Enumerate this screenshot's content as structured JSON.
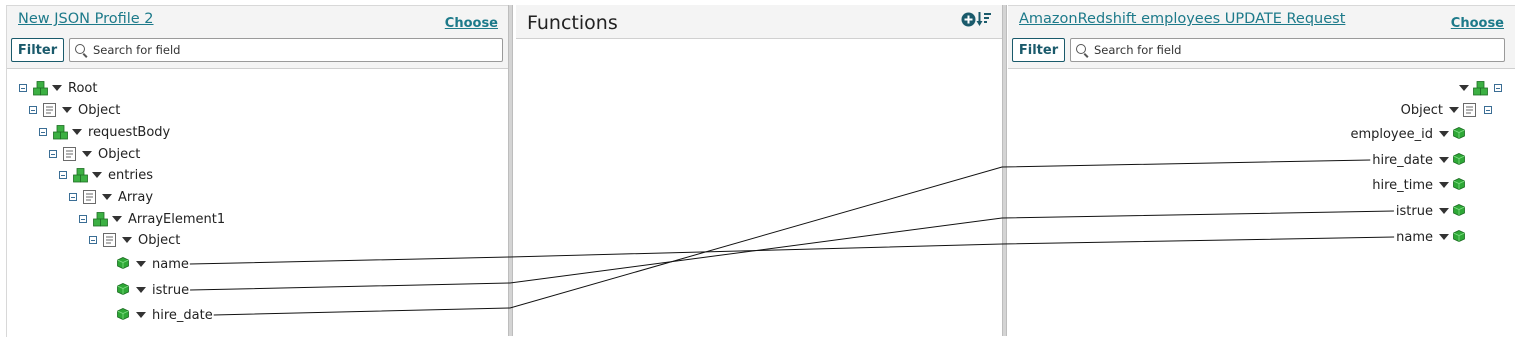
{
  "left": {
    "title": "New JSON Profile 2",
    "choose": "Choose",
    "filter": "Filter",
    "search_placeholder": "Search for field",
    "tree": [
      {
        "label": "Root",
        "icon": "cubes-icon"
      },
      {
        "label": "Object",
        "icon": "document-icon"
      },
      {
        "label": "requestBody",
        "icon": "cubes-icon"
      },
      {
        "label": "Object",
        "icon": "document-icon"
      },
      {
        "label": "entries",
        "icon": "cubes-icon"
      },
      {
        "label": "Array",
        "icon": "document-icon"
      },
      {
        "label": "ArrayElement1",
        "icon": "cubes-icon"
      },
      {
        "label": "Object",
        "icon": "document-icon"
      },
      {
        "label": "name",
        "icon": "cube-icon"
      },
      {
        "label": "istrue",
        "icon": "cube-icon"
      },
      {
        "label": "hire_date",
        "icon": "cube-icon"
      }
    ]
  },
  "functions": {
    "title": "Functions",
    "add_icon": "plus-circle-icon",
    "sort_icon": "sort-icon"
  },
  "right": {
    "title": "AmazonRedshift employees UPDATE Request",
    "choose": "Choose",
    "filter": "Filter",
    "search_placeholder": "Search for field",
    "tree": [
      {
        "label": "",
        "icon": "cubes-icon"
      },
      {
        "label": "Object",
        "icon": "document-icon"
      },
      {
        "label": "employee_id",
        "icon": "cube-icon"
      },
      {
        "label": "hire_date",
        "icon": "cube-icon"
      },
      {
        "label": "hire_time",
        "icon": "cube-icon"
      },
      {
        "label": "istrue",
        "icon": "cube-icon"
      },
      {
        "label": "name",
        "icon": "cube-icon"
      }
    ]
  },
  "mappings": [
    {
      "from": "name",
      "to": "name"
    },
    {
      "from": "istrue",
      "to": "istrue"
    },
    {
      "from": "hire_date",
      "to": "hire_date"
    }
  ]
}
